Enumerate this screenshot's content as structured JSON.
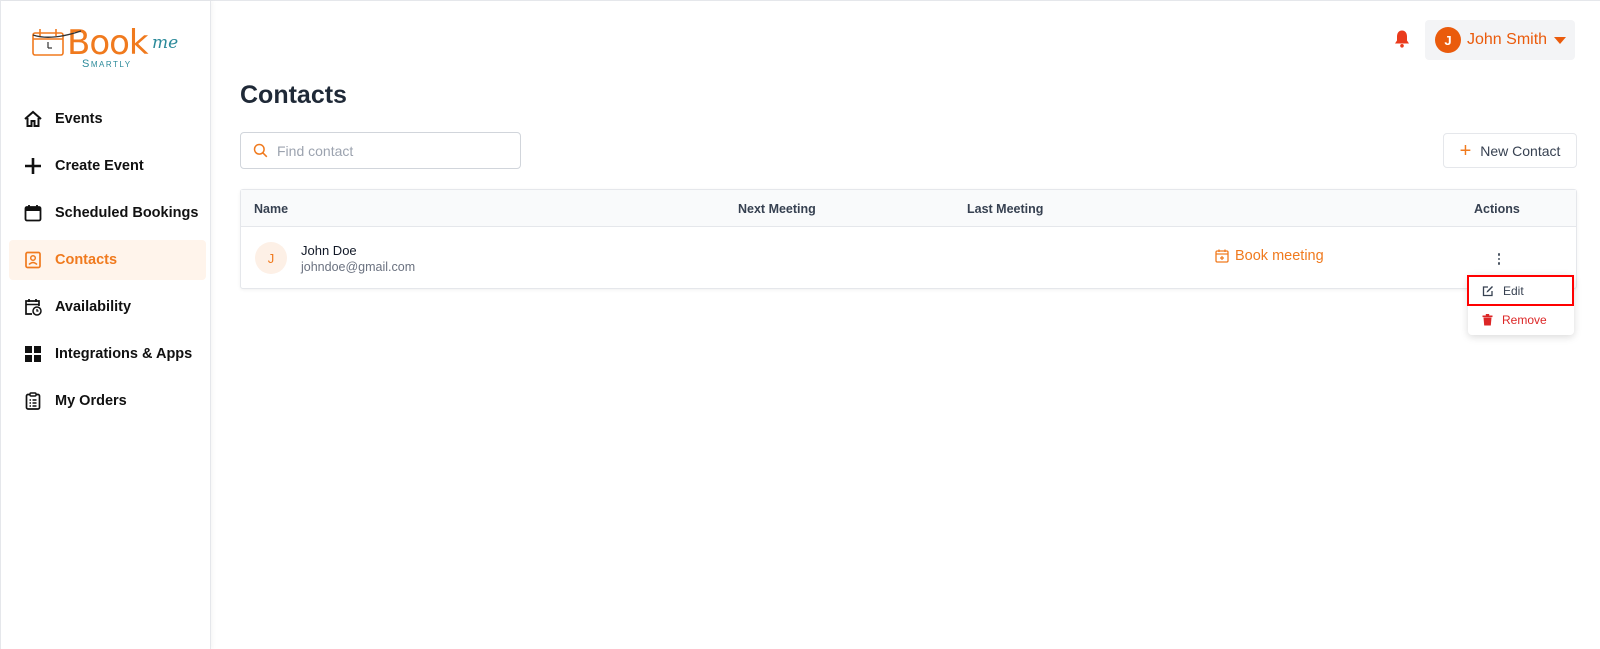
{
  "brand": {
    "word": "Book",
    "suffix": "me",
    "tagline": "Smartly",
    "color": "#f07a1e",
    "accent": "#2b8a9a"
  },
  "sidebar": {
    "items": [
      {
        "label": "Events",
        "icon": "home-icon",
        "active": false
      },
      {
        "label": "Create Event",
        "icon": "plus-icon",
        "active": false
      },
      {
        "label": "Scheduled Bookings",
        "icon": "calendar-icon",
        "active": false
      },
      {
        "label": "Contacts",
        "icon": "contact-book-icon",
        "active": true
      },
      {
        "label": "Availability",
        "icon": "calendar-clock-icon",
        "active": false
      },
      {
        "label": "Integrations & Apps",
        "icon": "grid-icon",
        "active": false
      },
      {
        "label": "My Orders",
        "icon": "clipboard-icon",
        "active": false
      }
    ]
  },
  "header": {
    "user_initial": "J",
    "user_name": "John Smith",
    "accent": "#ea5b0c"
  },
  "main": {
    "title": "Contacts",
    "search": {
      "placeholder": "Find contact",
      "value": ""
    },
    "new_contact_label": "New Contact",
    "table": {
      "columns": [
        "Name",
        "Next Meeting",
        "Last Meeting",
        "Actions"
      ],
      "rows": [
        {
          "initial": "J",
          "name": "John Doe",
          "email": "johndoe@gmail.com",
          "next_meeting": "",
          "last_meeting": "",
          "action_label": "Book meeting"
        }
      ]
    },
    "row_menu": {
      "edit_label": "Edit",
      "remove_label": "Remove"
    }
  }
}
